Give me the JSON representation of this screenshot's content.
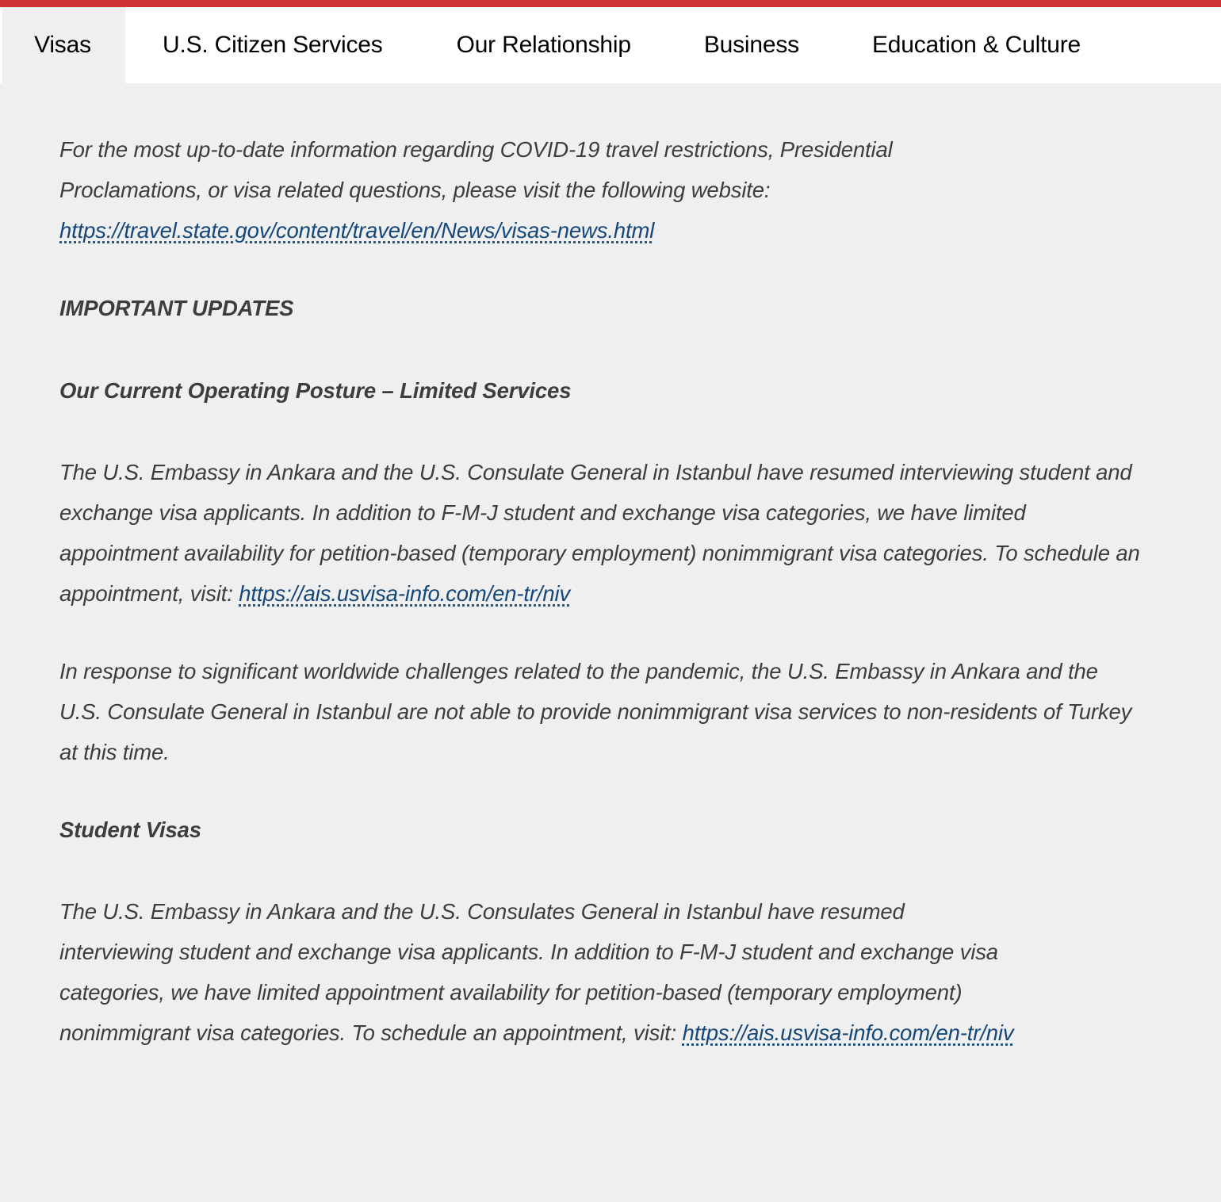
{
  "theme": {
    "accent_red": "#cd3333",
    "page_background": "#efefef",
    "tabbar_background": "#ffffff",
    "body_text": "#3d3d3d",
    "link_color": "#14477a",
    "tab_text": "#000000"
  },
  "tabs": [
    {
      "label": "Visas",
      "active": true
    },
    {
      "label": "U.S. Citizen Services",
      "active": false
    },
    {
      "label": "Our Relationship",
      "active": false
    },
    {
      "label": "Business",
      "active": false
    },
    {
      "label": "Education & Culture",
      "active": false
    }
  ],
  "content": {
    "intro": {
      "text_before_link": "For the most up-to-date information regarding COVID-19 travel restrictions, Presidential Proclamations, or visa related questions, please visit the following website: ",
      "link_text": "https://travel.state.gov/content/travel/en/News/visas-news.html"
    },
    "heading_important_updates": "IMPORTANT UPDATES",
    "heading_operating_posture": "Our Current Operating Posture – Limited Services",
    "paragraph_posture": {
      "text_before_link": "The U.S. Embassy in Ankara and the U.S. Consulate General in Istanbul have resumed interviewing student and exchange visa applicants. In addition to F-M-J student and exchange visa categories, we have limited appointment availability for petition-based (temporary employment) nonimmigrant visa categories. To schedule an appointment, visit: ",
      "link_text": "https://ais.usvisa-info.com/en-tr/niv"
    },
    "paragraph_pandemic": "In response to significant worldwide challenges related to the pandemic, the U.S. Embassy in Ankara and the U.S. Consulate General in Istanbul are not able to provide nonimmigrant visa services to non-residents of Turkey at this time.",
    "heading_student_visas": "Student Visas",
    "paragraph_student": {
      "text_before_link": "The U.S. Embassy in Ankara and the U.S. Consulates General in Istanbul have resumed interviewing student and exchange visa applicants. In addition to F-M-J student and exchange visa categories, we have limited appointment availability for petition-based (temporary employment) nonimmigrant visa categories. To schedule an appointment, visit: ",
      "link_text": "https://ais.usvisa-info.com/en-tr/niv"
    }
  }
}
